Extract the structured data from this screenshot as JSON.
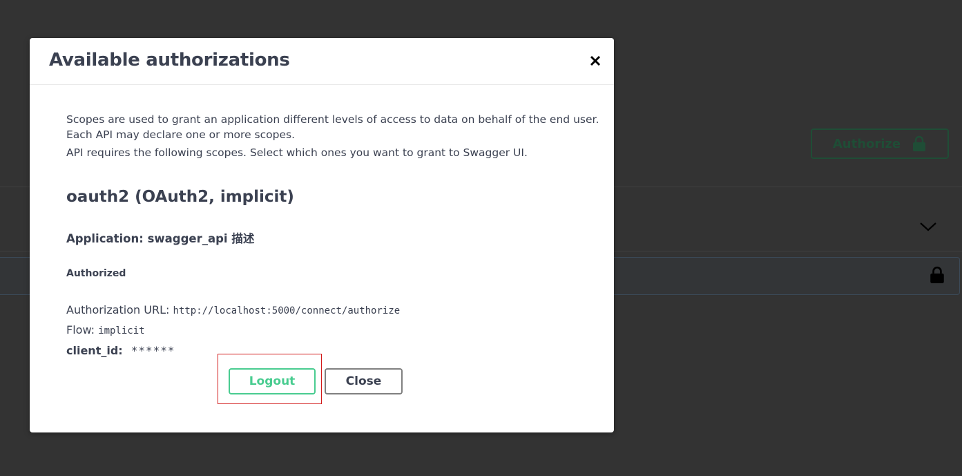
{
  "background": {
    "authorize_label": "Authorize"
  },
  "modal": {
    "title": "Available authorizations",
    "description_line1": "Scopes are used to grant an application different levels of access to data on behalf of the end user.",
    "description_line2": "Each API may declare one or more scopes.",
    "description_line3": "API requires the following scopes. Select which ones you want to grant to Swagger UI.",
    "scheme_title": "oauth2 (OAuth2, implicit)",
    "application": "Application: swagger_api 描述",
    "authorized_label": "Authorized",
    "auth_url_label": "Authorization URL:",
    "auth_url_value": "http://localhost:5000/connect/authorize",
    "flow_label": "Flow:",
    "flow_value": "implicit",
    "client_id_label": "client_id:",
    "client_id_value": "******",
    "logout_label": "Logout",
    "close_label": "Close"
  },
  "colors": {
    "accent_green": "#49cc90",
    "text": "#3b4151",
    "highlight_red": "#d21919"
  }
}
